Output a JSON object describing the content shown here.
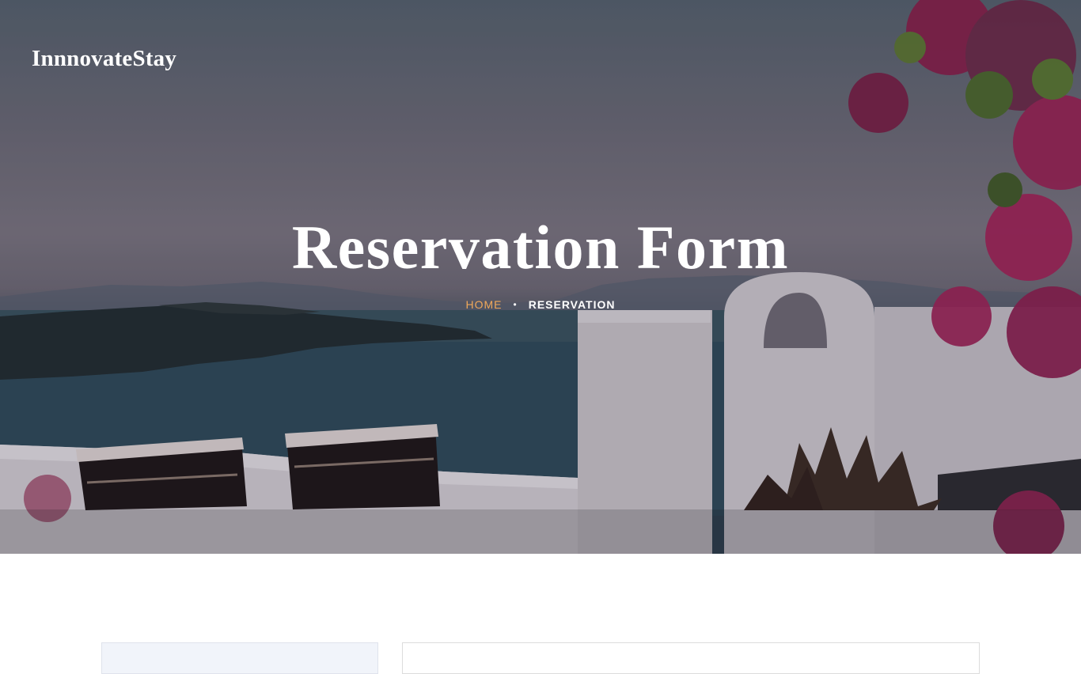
{
  "brand": {
    "logo_text": "InnnovateStay"
  },
  "hero": {
    "title": "Reservation Form",
    "breadcrumb": {
      "home_label": "HOME",
      "separator": "•",
      "current_label": "RESERVATION"
    }
  },
  "colors": {
    "breadcrumb_link": "#f0a85a",
    "title_text": "#ffffff",
    "sidebar_bg": "#f1f4fa",
    "page_bg": "#ffffff"
  }
}
